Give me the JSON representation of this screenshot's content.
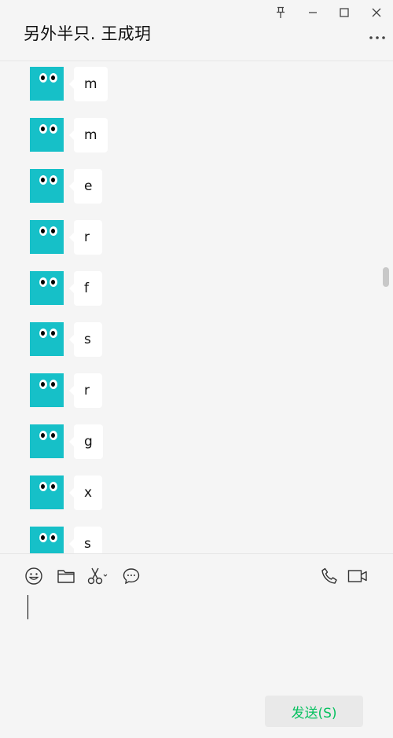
{
  "header": {
    "title": "另外半只. 王成玥"
  },
  "window_controls": {
    "pin_icon": "pin-icon",
    "minimize_icon": "minimize-icon",
    "maximize_icon": "maximize-icon",
    "close_icon": "close-icon",
    "more_icon": "more-dots-icon"
  },
  "messages": [
    {
      "text": "m"
    },
    {
      "text": "m"
    },
    {
      "text": "e"
    },
    {
      "text": "r"
    },
    {
      "text": "f"
    },
    {
      "text": "s"
    },
    {
      "text": "r"
    },
    {
      "text": "g"
    },
    {
      "text": "x"
    },
    {
      "text": "s"
    }
  ],
  "toolbar": {
    "icons": [
      "emoji-icon",
      "folder-icon",
      "scissors-icon",
      "chat-history-icon",
      "phone-icon",
      "video-icon"
    ]
  },
  "composer": {
    "value": "",
    "send_label": "发送(S)"
  },
  "colors": {
    "background": "#f5f5f5",
    "avatar": "#16c0c8",
    "bubble": "#ffffff",
    "send_text": "#07c160",
    "send_button": "#e9e9e9"
  }
}
